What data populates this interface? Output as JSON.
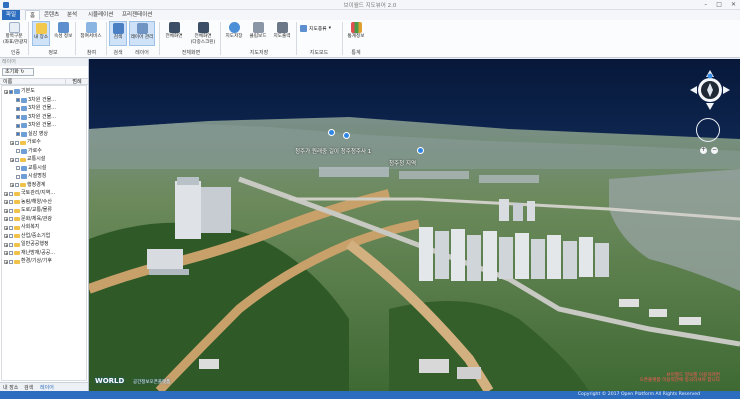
{
  "window": {
    "title": "브이월드 지도뷰어 2.0"
  },
  "menu": {
    "tabs": [
      "파일",
      "홈",
      "콘텐츠",
      "분석",
      "시뮬레이션",
      "프리젠테이션"
    ]
  },
  "ribbon": {
    "buttons": [
      {
        "label": "항목구분",
        "sub": "(좌표/관광지)",
        "icon": "target-icon"
      },
      {
        "label": "내 장소",
        "icon": "star-icon"
      },
      {
        "label": "속성 정보",
        "icon": "info-icon"
      },
      {
        "label": "참여서비스",
        "icon": "people-icon"
      },
      {
        "label": "검색",
        "icon": "search-icon"
      },
      {
        "label": "레이어 관리",
        "icon": "layers-icon"
      },
      {
        "label": "전체화면",
        "icon": "monitor-icon"
      },
      {
        "label": "전체화면",
        "sub": "(다중스크린)",
        "icon": "multiscreen-icon"
      },
      {
        "label": "지도저장",
        "icon": "globe-icon"
      },
      {
        "label": "클립보드",
        "icon": "clipboard-icon"
      },
      {
        "label": "지도출력",
        "icon": "printer-icon"
      },
      {
        "label": "지도종류",
        "icon": "map-type-icon"
      },
      {
        "label": "통계정보",
        "icon": "chart-icon"
      }
    ],
    "groups": [
      "인증",
      "정보",
      "참여",
      "검색",
      "레이어",
      "전체화면",
      "지도저장",
      "지도모드",
      "통계"
    ]
  },
  "panel": {
    "title": "레이어",
    "reset": "초기화",
    "columns": [
      "이름",
      "범례"
    ],
    "tree": [
      {
        "label": "기본도",
        "level": 0,
        "type": "layer",
        "checked": true
      },
      {
        "label": "3차원 건물...",
        "level": 2,
        "type": "layer",
        "checked": true
      },
      {
        "label": "3차원 건물...",
        "level": 2,
        "type": "layer",
        "checked": true
      },
      {
        "label": "3차원 건물...",
        "level": 2,
        "type": "layer",
        "checked": true
      },
      {
        "label": "3차원 건물...",
        "level": 2,
        "type": "layer",
        "checked": true
      },
      {
        "label": "실감 영상",
        "level": 2,
        "type": "layer",
        "checked": true
      },
      {
        "label": "가로수",
        "level": 1,
        "type": "folder",
        "checked": false
      },
      {
        "label": "가로수",
        "level": 2,
        "type": "layer",
        "checked": false
      },
      {
        "label": "교통시설",
        "level": 1,
        "type": "folder",
        "checked": false
      },
      {
        "label": "교통시설",
        "level": 2,
        "type": "layer",
        "checked": false
      },
      {
        "label": "시설명칭",
        "level": 2,
        "type": "layer",
        "checked": false
      },
      {
        "label": "행정경계",
        "level": 1,
        "type": "folder",
        "checked": false
      },
      {
        "label": "국토관리/지역...",
        "level": 0,
        "type": "folder",
        "checked": false
      },
      {
        "label": "농림/해양/수산",
        "level": 0,
        "type": "folder",
        "checked": false
      },
      {
        "label": "도로/교통/물류",
        "level": 0,
        "type": "folder",
        "checked": false
      },
      {
        "label": "문화/체육/관광",
        "level": 0,
        "type": "folder",
        "checked": false
      },
      {
        "label": "사회복지",
        "level": 0,
        "type": "folder",
        "checked": false
      },
      {
        "label": "산업/중소기업",
        "level": 0,
        "type": "folder",
        "checked": false
      },
      {
        "label": "일반공공행정",
        "level": 0,
        "type": "folder",
        "checked": false
      },
      {
        "label": "재난방재/공공...",
        "level": 0,
        "type": "folder",
        "checked": false
      },
      {
        "label": "환경/기상/기후",
        "level": 0,
        "type": "folder",
        "checked": false
      }
    ],
    "bottom_tabs": [
      "내 장소",
      "검색",
      "레이어"
    ]
  },
  "map": {
    "labels": [
      {
        "text": "청주가 원래중 길이 청주청주사 1"
      },
      {
        "text": "청주청 지역"
      }
    ],
    "logo": "WORLD",
    "logo_sub": "공간정보오픈플랫폼",
    "legal": [
      "브이월드 정보를 이용하려면",
      "오픈플랫폼 이용약관에 동의하셔야 합니다"
    ],
    "copyright": "Copyright © 2017 Open Platform All Rights Reserved"
  },
  "colors": {
    "accent": "#2d6dbf",
    "road": "#c8a06a",
    "pin": "#2f86e6"
  }
}
